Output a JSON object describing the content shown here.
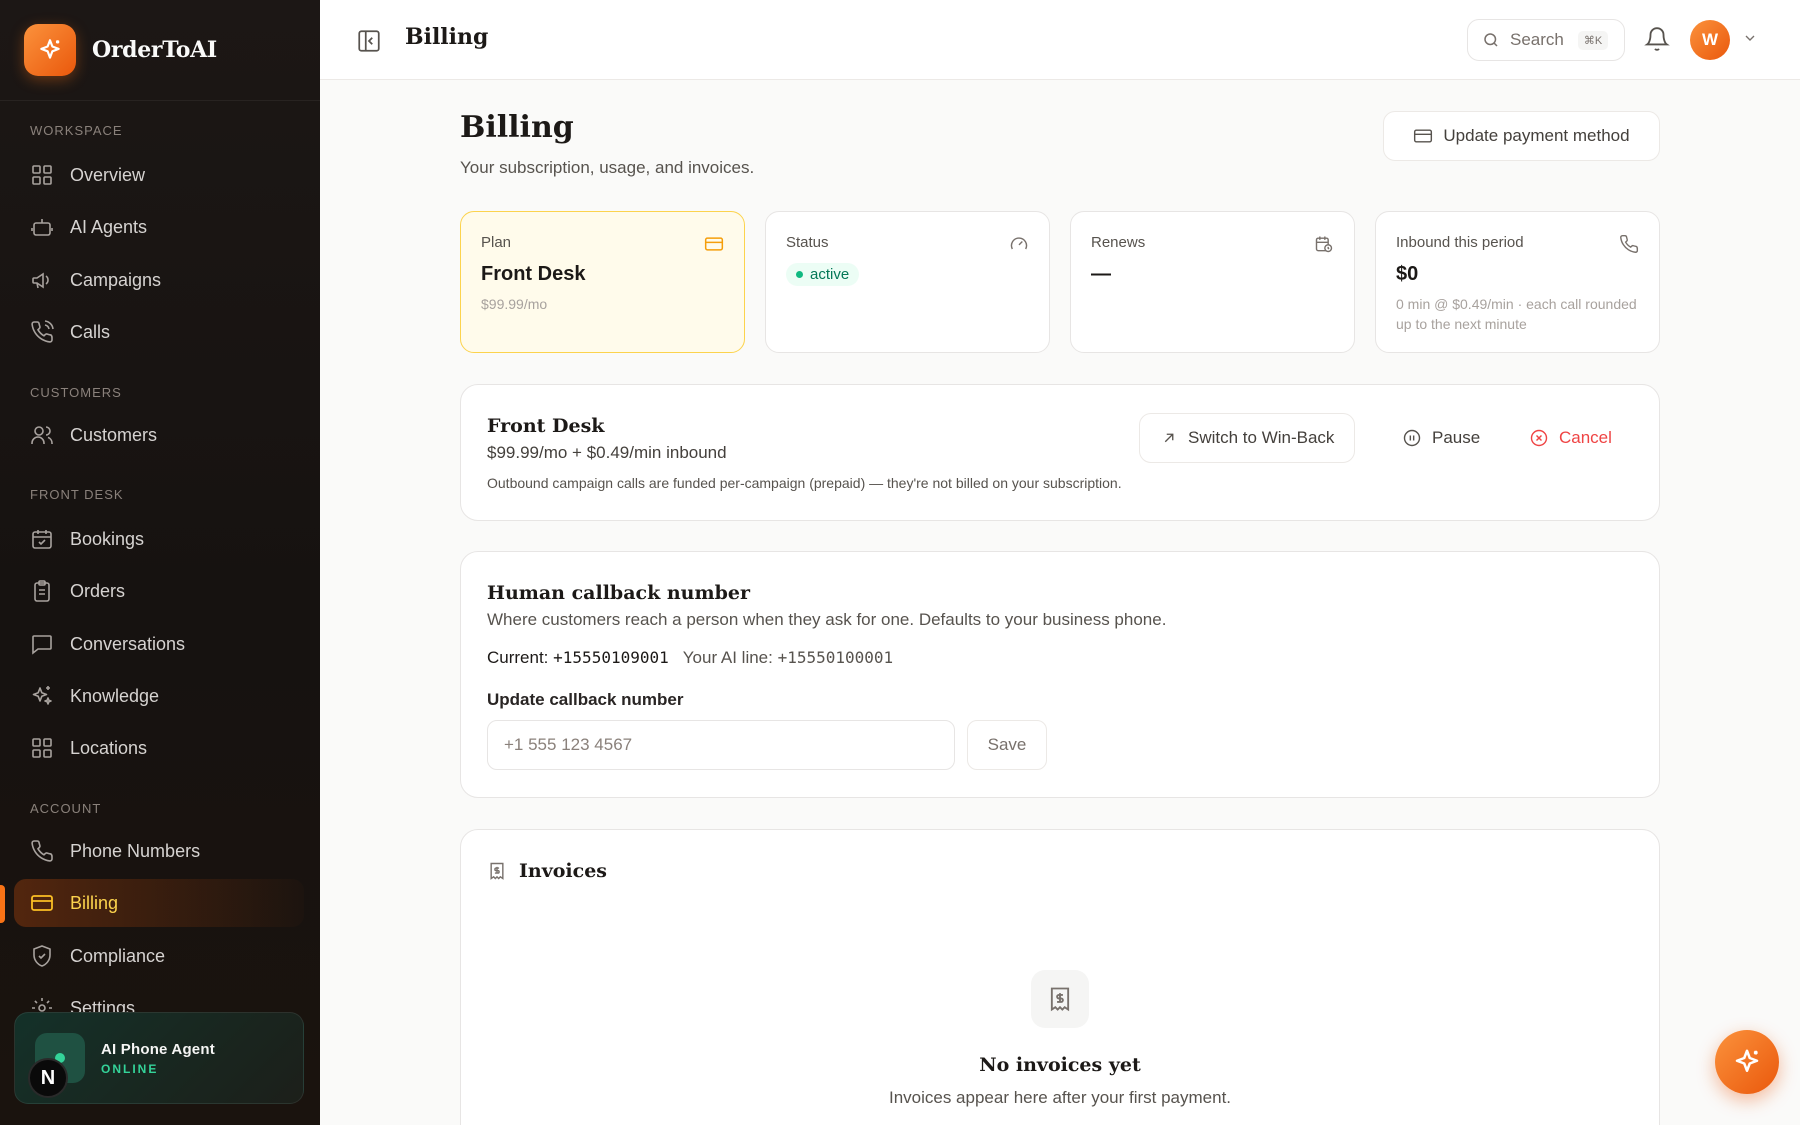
{
  "brand": {
    "name": "OrderToAI"
  },
  "sidebar": {
    "sections": [
      {
        "label": "WORKSPACE"
      },
      {
        "label": "CUSTOMERS"
      },
      {
        "label": "FRONT DESK"
      },
      {
        "label": "ACCOUNT"
      }
    ],
    "items": [
      {
        "label": "Overview",
        "icon": "grid-icon"
      },
      {
        "label": "AI Agents",
        "icon": "robot-icon"
      },
      {
        "label": "Campaigns",
        "icon": "megaphone-icon"
      },
      {
        "label": "Calls",
        "icon": "phone-call-icon"
      },
      {
        "label": "Customers",
        "icon": "users-icon"
      },
      {
        "label": "Bookings",
        "icon": "calendar-icon"
      },
      {
        "label": "Orders",
        "icon": "clipboard-icon"
      },
      {
        "label": "Conversations",
        "icon": "chat-icon"
      },
      {
        "label": "Knowledge",
        "icon": "sparkles-icon"
      },
      {
        "label": "Locations",
        "icon": "grid-icon"
      },
      {
        "label": "Phone Numbers",
        "icon": "phone-icon"
      },
      {
        "label": "Billing",
        "icon": "credit-card-icon",
        "active": true
      },
      {
        "label": "Compliance",
        "icon": "shield-check-icon"
      },
      {
        "label": "Settings",
        "icon": "gear-icon"
      }
    ],
    "agent": {
      "name": "AI Phone Agent",
      "status": "ONLINE"
    },
    "badge": "N"
  },
  "topbar": {
    "title": "Billing",
    "search_label": "Search",
    "search_shortcut": "⌘K",
    "avatar_initial": "W"
  },
  "page": {
    "title": "Billing",
    "subtitle": "Your subscription, usage, and invoices.",
    "update_payment_label": "Update payment method"
  },
  "stats": {
    "plan": {
      "label": "Plan",
      "value": "Front Desk",
      "sub": "$99.99/mo"
    },
    "status": {
      "label": "Status",
      "value": "active"
    },
    "renews": {
      "label": "Renews",
      "value": "—"
    },
    "inbound": {
      "label": "Inbound this period",
      "value": "$0",
      "sub": "0 min @ $0.49/min · each call rounded up to the next minute"
    }
  },
  "plan_card": {
    "title": "Front Desk",
    "price": "$99.99/mo + $0.49/min inbound",
    "note": "Outbound campaign calls are funded per-campaign (prepaid) — they're not billed on your subscription.",
    "switch_label": "Switch to Win-Back",
    "pause_label": "Pause",
    "cancel_label": "Cancel"
  },
  "callback": {
    "title": "Human callback number",
    "description": "Where customers reach a person when they ask for one. Defaults to your business phone.",
    "current_label": "Current:",
    "current_value": "+15550109001",
    "ai_line_label": "Your AI line:",
    "ai_line_value": "+15550100001",
    "update_label": "Update callback number",
    "placeholder": "+1 555 123 4567",
    "save_label": "Save"
  },
  "invoices": {
    "title": "Invoices",
    "empty_title": "No invoices yet",
    "empty_subtitle": "Invoices appear here after your first payment."
  },
  "colors": {
    "accent": "#f97316",
    "success": "#10b981",
    "danger": "#ef4444"
  }
}
